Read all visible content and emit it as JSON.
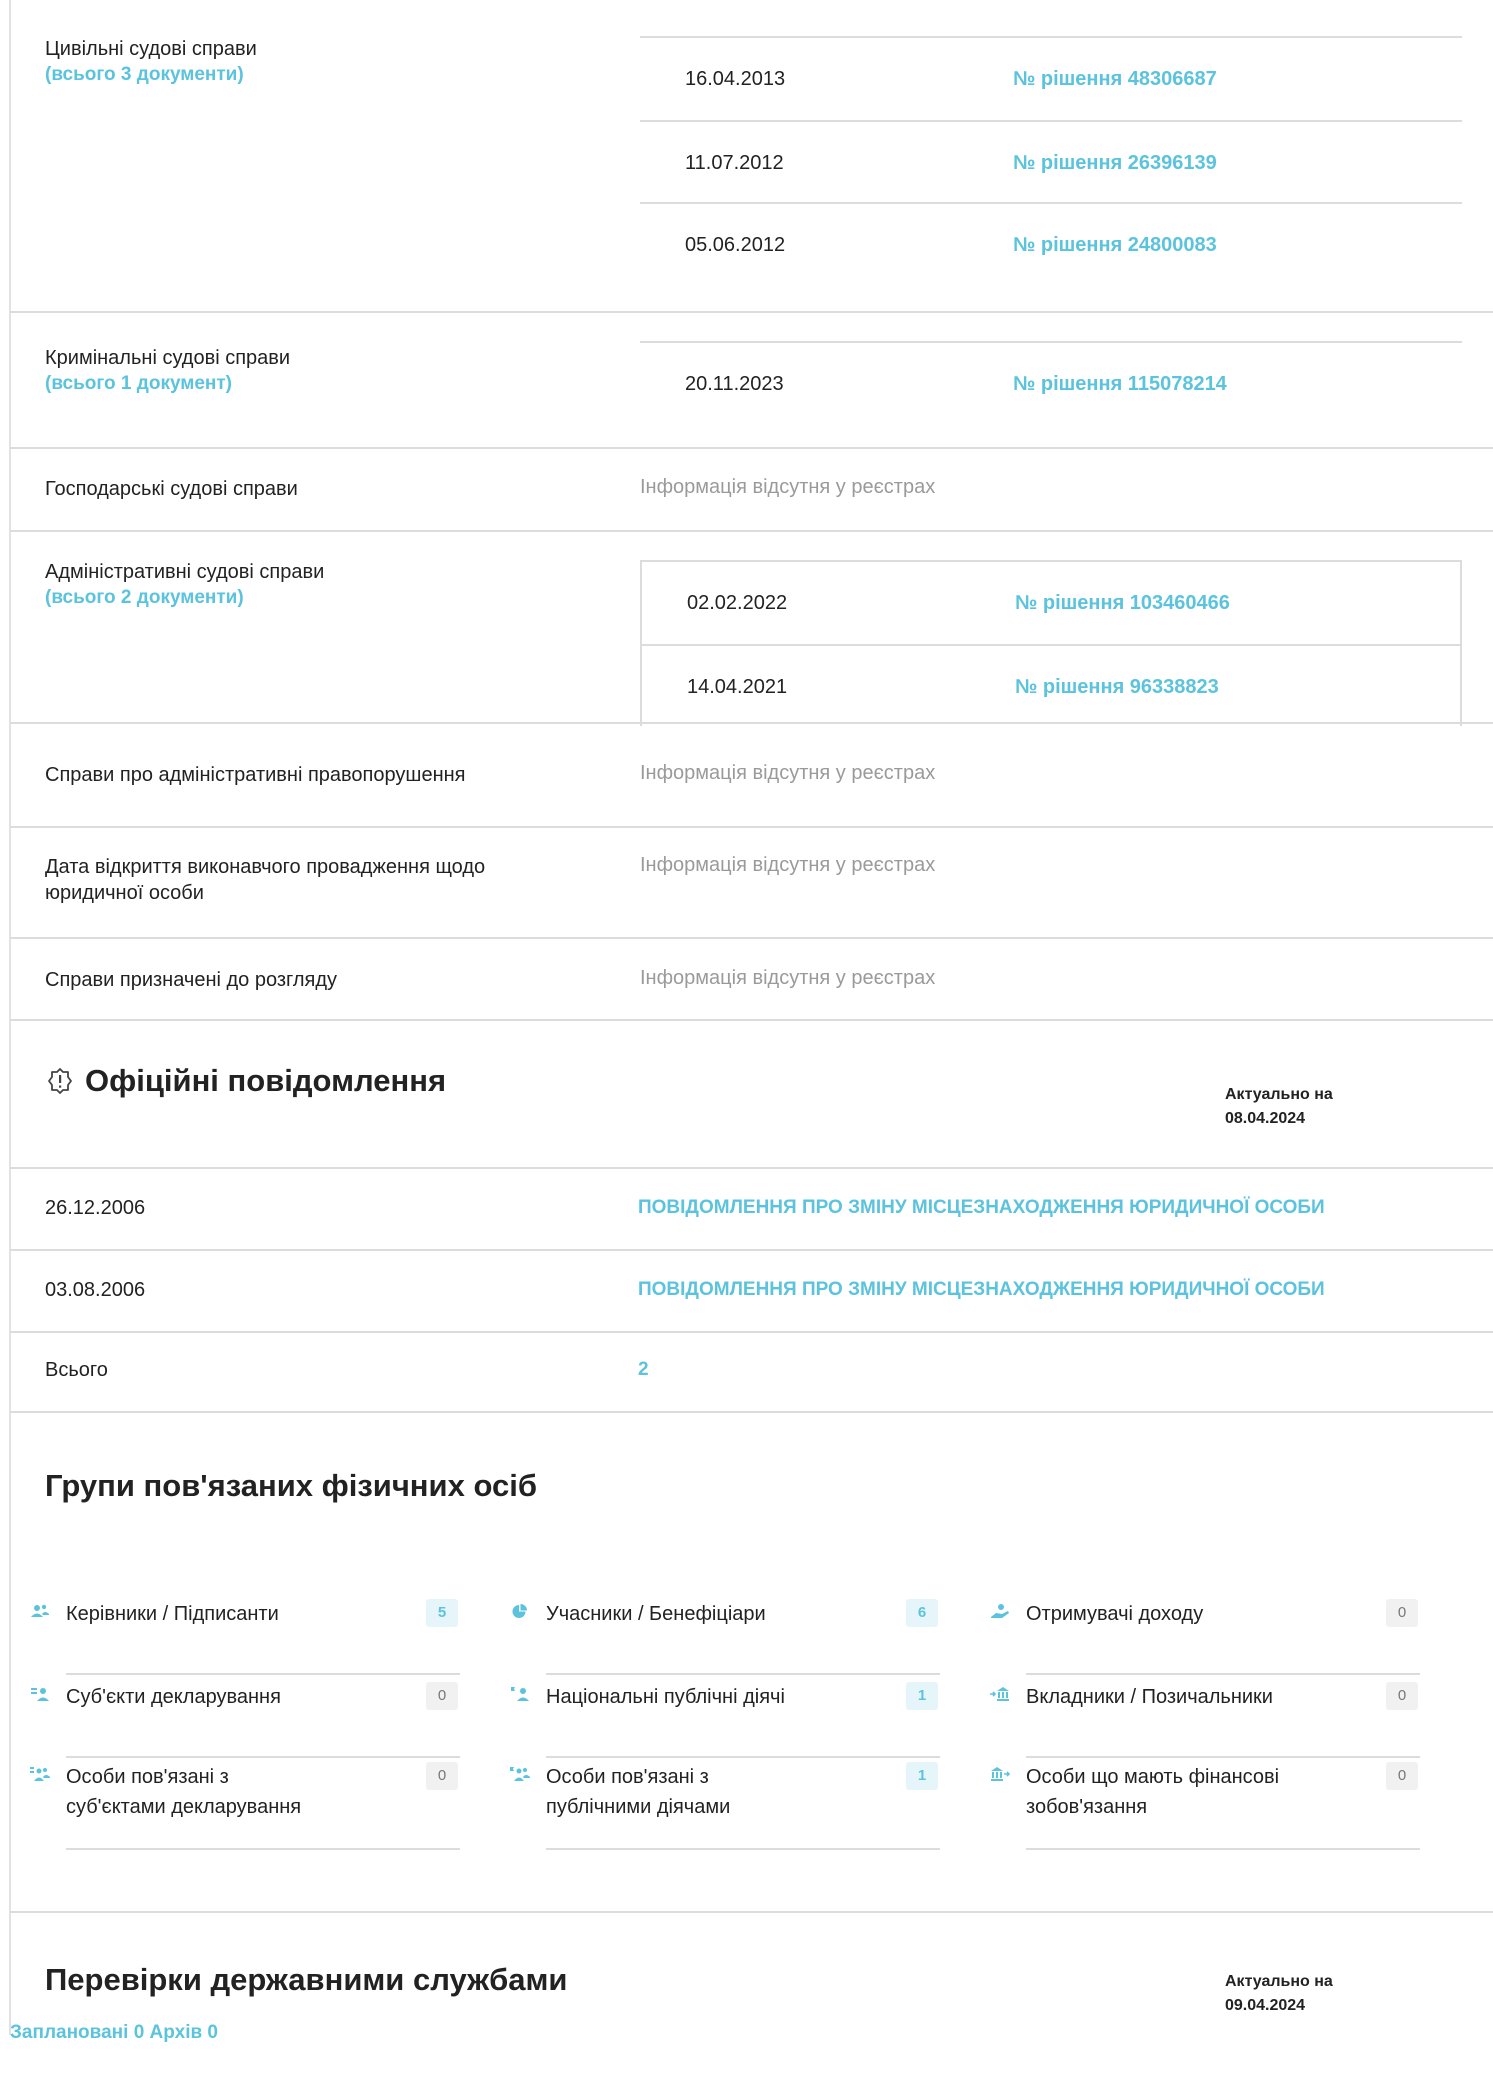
{
  "court_cases": {
    "civil": {
      "label": "Цивільні судові справи",
      "count": "(всього 3 документи)",
      "docs": [
        {
          "date": "16.04.2013",
          "number": "№ рішення 48306687"
        },
        {
          "date": "11.07.2012",
          "number": "№ рішення 26396139"
        },
        {
          "date": "05.06.2012",
          "number": "№ рішення 24800083"
        }
      ]
    },
    "criminal": {
      "label": "Кримінальні судові справи",
      "count": "(всього 1 документ)",
      "docs": [
        {
          "date": "20.11.2023",
          "number": "№ рішення 115078214"
        }
      ]
    },
    "commercial": {
      "label": "Господарські судові справи",
      "value": "Інформація відсутня у реєстрах"
    },
    "administrative": {
      "label": "Адміністративні судові справи",
      "count": "(всього 2 документи)",
      "docs": [
        {
          "date": "02.02.2022",
          "number": "№ рішення 103460466"
        },
        {
          "date": "14.04.2021",
          "number": "№ рішення 96338823"
        }
      ]
    },
    "offenses": {
      "label": "Справи про адміністративні правопорушення",
      "value": "Інформація відсутня у реєстрах"
    },
    "enforcement": {
      "label_line1": "Дата відкриття виконавчого провадження щодо",
      "label_line2": "юридичної особи",
      "value": "Інформація відсутня у реєстрах"
    },
    "scheduled": {
      "label": "Справи призначені до розгляду",
      "value": "Інформація відсутня у реєстрах"
    }
  },
  "notices": {
    "title": "Офіційні повідомлення",
    "actual_label": "Актуально на",
    "actual_date": "08.04.2024",
    "items": [
      {
        "date": "26.12.2006",
        "text": "ПОВІДОМЛЕННЯ ПРО ЗМІНУ МІСЦЕЗНАХОДЖЕННЯ ЮРИДИЧНОЇ ОСОБИ"
      },
      {
        "date": "03.08.2006",
        "text": "ПОВІДОМЛЕННЯ ПРО ЗМІНУ МІСЦЕЗНАХОДЖЕННЯ ЮРИДИЧНОЇ ОСОБИ"
      }
    ],
    "total_label": "Всього",
    "total_value": "2"
  },
  "groups": {
    "title": "Групи пов'язаних фізичних осіб",
    "items": [
      {
        "label": "Керівники / Підписанти",
        "count": "5",
        "icon": "people-icon"
      },
      {
        "label": "Учасники / Бенефіціари",
        "count": "6",
        "icon": "pie-chart-icon"
      },
      {
        "label": "Отримувачі доходу",
        "count": "0",
        "icon": "income-hand-icon"
      },
      {
        "label": "Суб'єкти декларування",
        "count": "0",
        "icon": "declarants-icon"
      },
      {
        "label": "Національні публічні діячі",
        "count": "1",
        "icon": "public-figure-icon"
      },
      {
        "label": "Вкладники / Позичальники",
        "count": "0",
        "icon": "bank-transfer-icon"
      },
      {
        "label_line1": "Особи пов'язані з",
        "label_line2": "суб'єктами декларування",
        "count": "0",
        "icon": "related-declarants-icon"
      },
      {
        "label_line1": "Особи пов'язані з",
        "label_line2": "публічними діячами",
        "count": "1",
        "icon": "related-public-icon"
      },
      {
        "label_line1": "Особи що мають фінансові",
        "label_line2": "зобов'язання",
        "count": "0",
        "icon": "bank-obligation-icon"
      }
    ]
  },
  "inspections": {
    "title": "Перевірки державними службами",
    "actual_label": "Актуально на",
    "actual_date": "09.04.2024",
    "tab_planned": "Заплановані 0",
    "tab_archive": "Архів 0"
  },
  "colors": {
    "accent": "#5bc3dd",
    "muted": "#9a9a9a",
    "rule": "#dcdcdc",
    "text": "#222222"
  }
}
